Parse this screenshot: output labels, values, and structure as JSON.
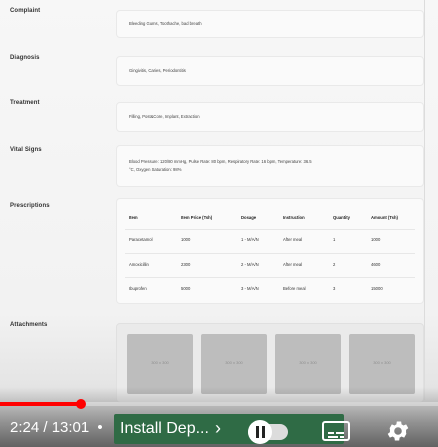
{
  "record": {
    "complaint": {
      "label": "Complaint",
      "value": "Bleeding Gums, Toothache, bad breath"
    },
    "diagnosis": {
      "label": "Diagnosis",
      "value": "Gingivitis, Caries, Periodontitis"
    },
    "treatment": {
      "label": "Treatment",
      "value": "Filling, Post&Core, Implant, Extraction"
    },
    "vitals": {
      "label": "Vital Signs",
      "value_line1": "Blood Pressure: 120/80 mmHg, Pulse Rate: 80 bpm, Respiratory Rate: 16 bpm, Temperature: 36.5",
      "value_line2": "°C, Oxygen Saturation: 98%"
    },
    "prescriptions": {
      "label": "Prescriptions",
      "columns": [
        "Item",
        "Item Price (Tsh)",
        "Dosage",
        "Instruction",
        "Quantity",
        "Amount (Tsh)"
      ],
      "rows": [
        [
          "Paracetamol",
          "1000",
          "1 - M/A/N",
          "After meal",
          "1",
          "1000"
        ],
        [
          "Amoxicillin",
          "2300",
          "2 - M/A/N",
          "After meal",
          "2",
          "4600"
        ],
        [
          "Ibuprofen",
          "5000",
          "3 - M/A/N",
          "Before meal",
          "3",
          "15000"
        ]
      ]
    },
    "attachments": {
      "label": "Attachments",
      "thumbs": [
        "300 x 300",
        "300 x 300",
        "300 x 300",
        "300 x 300"
      ]
    }
  },
  "player": {
    "time": "2:24 / 13:01",
    "separator": "•",
    "chapter": "Install Dep...",
    "chevron": "›",
    "progress": 0.184
  }
}
